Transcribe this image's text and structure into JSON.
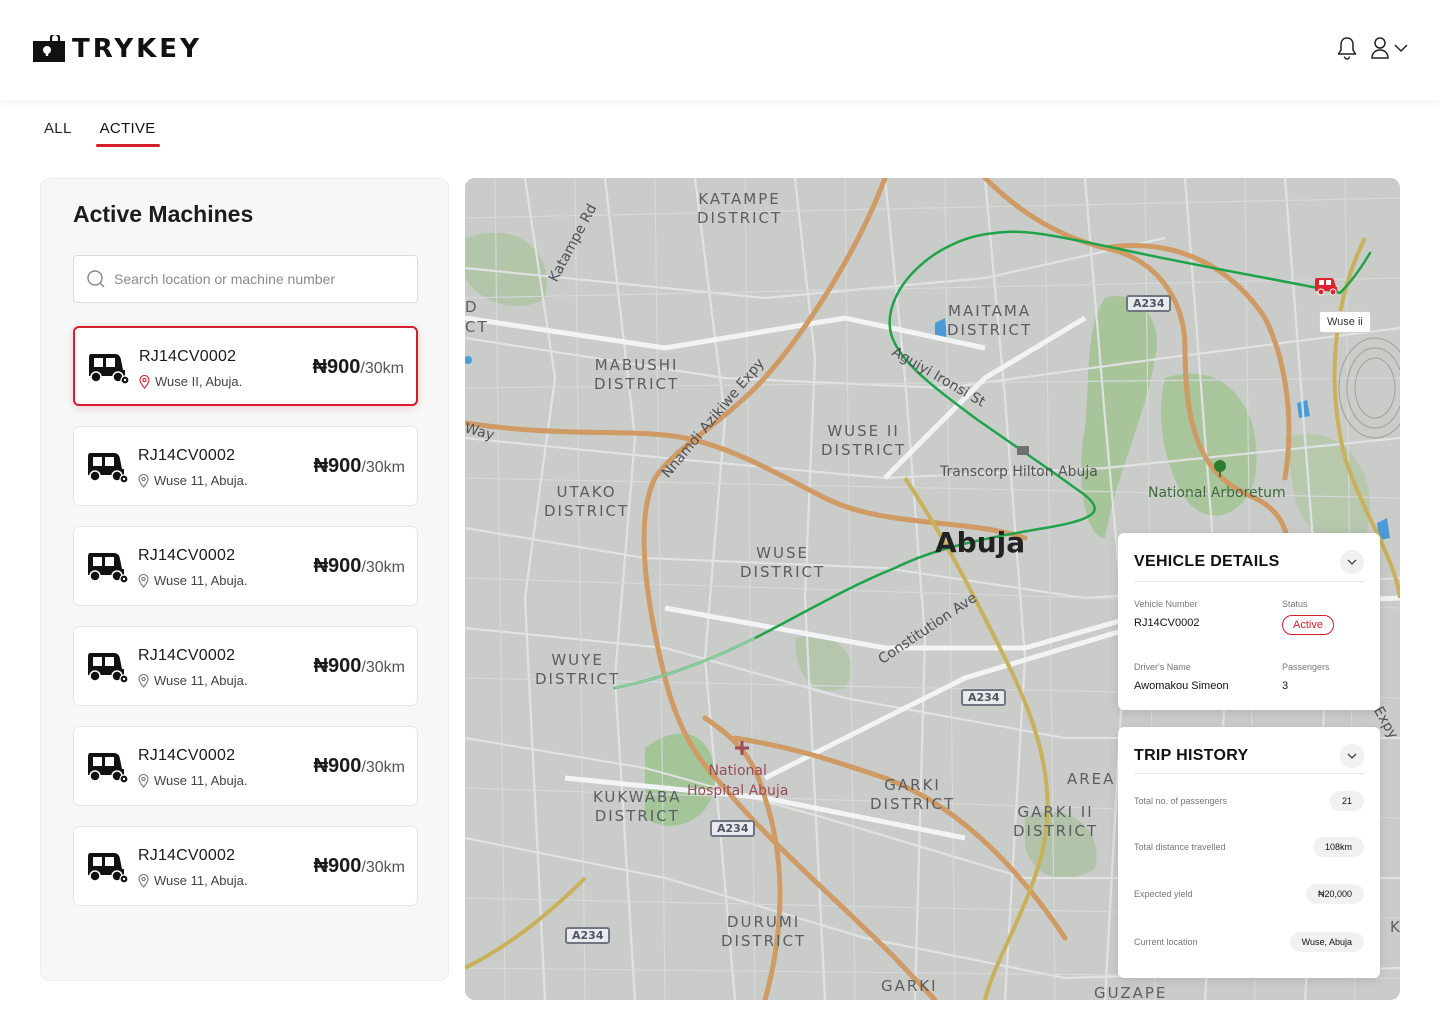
{
  "header": {
    "brand": "TRYKEY",
    "logo_icon": "lock-icon",
    "bell_icon": "bell-icon",
    "user_icon": "user-icon",
    "chevron_icon": "chevron-down-icon"
  },
  "tabs": [
    {
      "label": "ALL",
      "active": false
    },
    {
      "label": "ACTIVE",
      "active": true
    }
  ],
  "panel": {
    "title": "Active Machines",
    "search_placeholder": "Search location or machine number"
  },
  "machines": [
    {
      "number": "RJ14CV0002",
      "location": "Wuse II, Abuja.",
      "price": "₦900",
      "unit": "/30km",
      "selected": true
    },
    {
      "number": "RJ14CV0002",
      "location": "Wuse 11, Abuja.",
      "price": "₦900",
      "unit": "/30km",
      "selected": false
    },
    {
      "number": "RJ14CV0002",
      "location": "Wuse 11, Abuja.",
      "price": "₦900",
      "unit": "/30km",
      "selected": false
    },
    {
      "number": "RJ14CV0002",
      "location": "Wuse 11, Abuja.",
      "price": "₦900",
      "unit": "/30km",
      "selected": false
    },
    {
      "number": "RJ14CV0002",
      "location": "Wuse 11, Abuja.",
      "price": "₦900",
      "unit": "/30km",
      "selected": false
    },
    {
      "number": "RJ14CV0002",
      "location": "Wuse 11, Abuja.",
      "price": "₦900",
      "unit": "/30km",
      "selected": false
    }
  ],
  "map": {
    "districts": {
      "katampe": "KATAMPE\nDISTRICT",
      "maitama": "MAITAMA\nDISTRICT",
      "mabushi": "MABUSHI\nDISTRICT",
      "wuse2": "WUSE II\nDISTRICT",
      "utako": "UTAKO\nDISTRICT",
      "wuse": "WUSE\nDISTRICT",
      "wuye": "WUYE\nDISTRICT",
      "kukwaba": "KUKWABA\nDISTRICT",
      "garki": "GARKI\nDISTRICT",
      "garki2": "GARKI II\nDISTRICT",
      "area": "AREA",
      "durumi": "DURUMI\nDISTRICT",
      "garki_bottom": "GARKI",
      "guzape": "GUZAPE"
    },
    "city": "Abuja",
    "streets": {
      "katampe_rd": "Katampe Rd",
      "nnamdi": "Nnamdi Azikiwe Expy",
      "aguiyi": "Aguiyi Ironsi St",
      "constitution": "Constitution Ave",
      "way": "Way",
      "expy": "Expy"
    },
    "pois": {
      "hilton": "Transcorp Hilton Abuja",
      "arboretum": "National Arboretum",
      "hospital": "National\nHospital Abuja"
    },
    "road_badges": [
      "A234",
      "A234",
      "A234",
      "A234"
    ],
    "vehicle_tag": "Wuse ii",
    "route_color": "#1fa34a",
    "edge_letters": {
      "left_top": "D",
      "left_second": "CT",
      "right_k": "K"
    }
  },
  "vehicle_details": {
    "title": "VEHICLE DETAILS",
    "vehicle_number_label": "Vehicle Number",
    "vehicle_number": "RJ14CV0002",
    "status_label": "Status",
    "status": "Active",
    "driver_label": "Driver's Name",
    "driver": "Awomakou Simeon",
    "passengers_label": "Passengers",
    "passengers": "3"
  },
  "trip_history": {
    "title": "TRIP HISTORY",
    "rows": [
      {
        "label": "Total no. of passengers",
        "value": "21"
      },
      {
        "label": "Total distance travelled",
        "value": "108km"
      },
      {
        "label": "Expected yield",
        "value": "₦20,000"
      },
      {
        "label": "Current location",
        "value": "Wuse, Abuja"
      }
    ]
  },
  "colors": {
    "accent": "#d31f2c",
    "route": "#1fa34a"
  }
}
